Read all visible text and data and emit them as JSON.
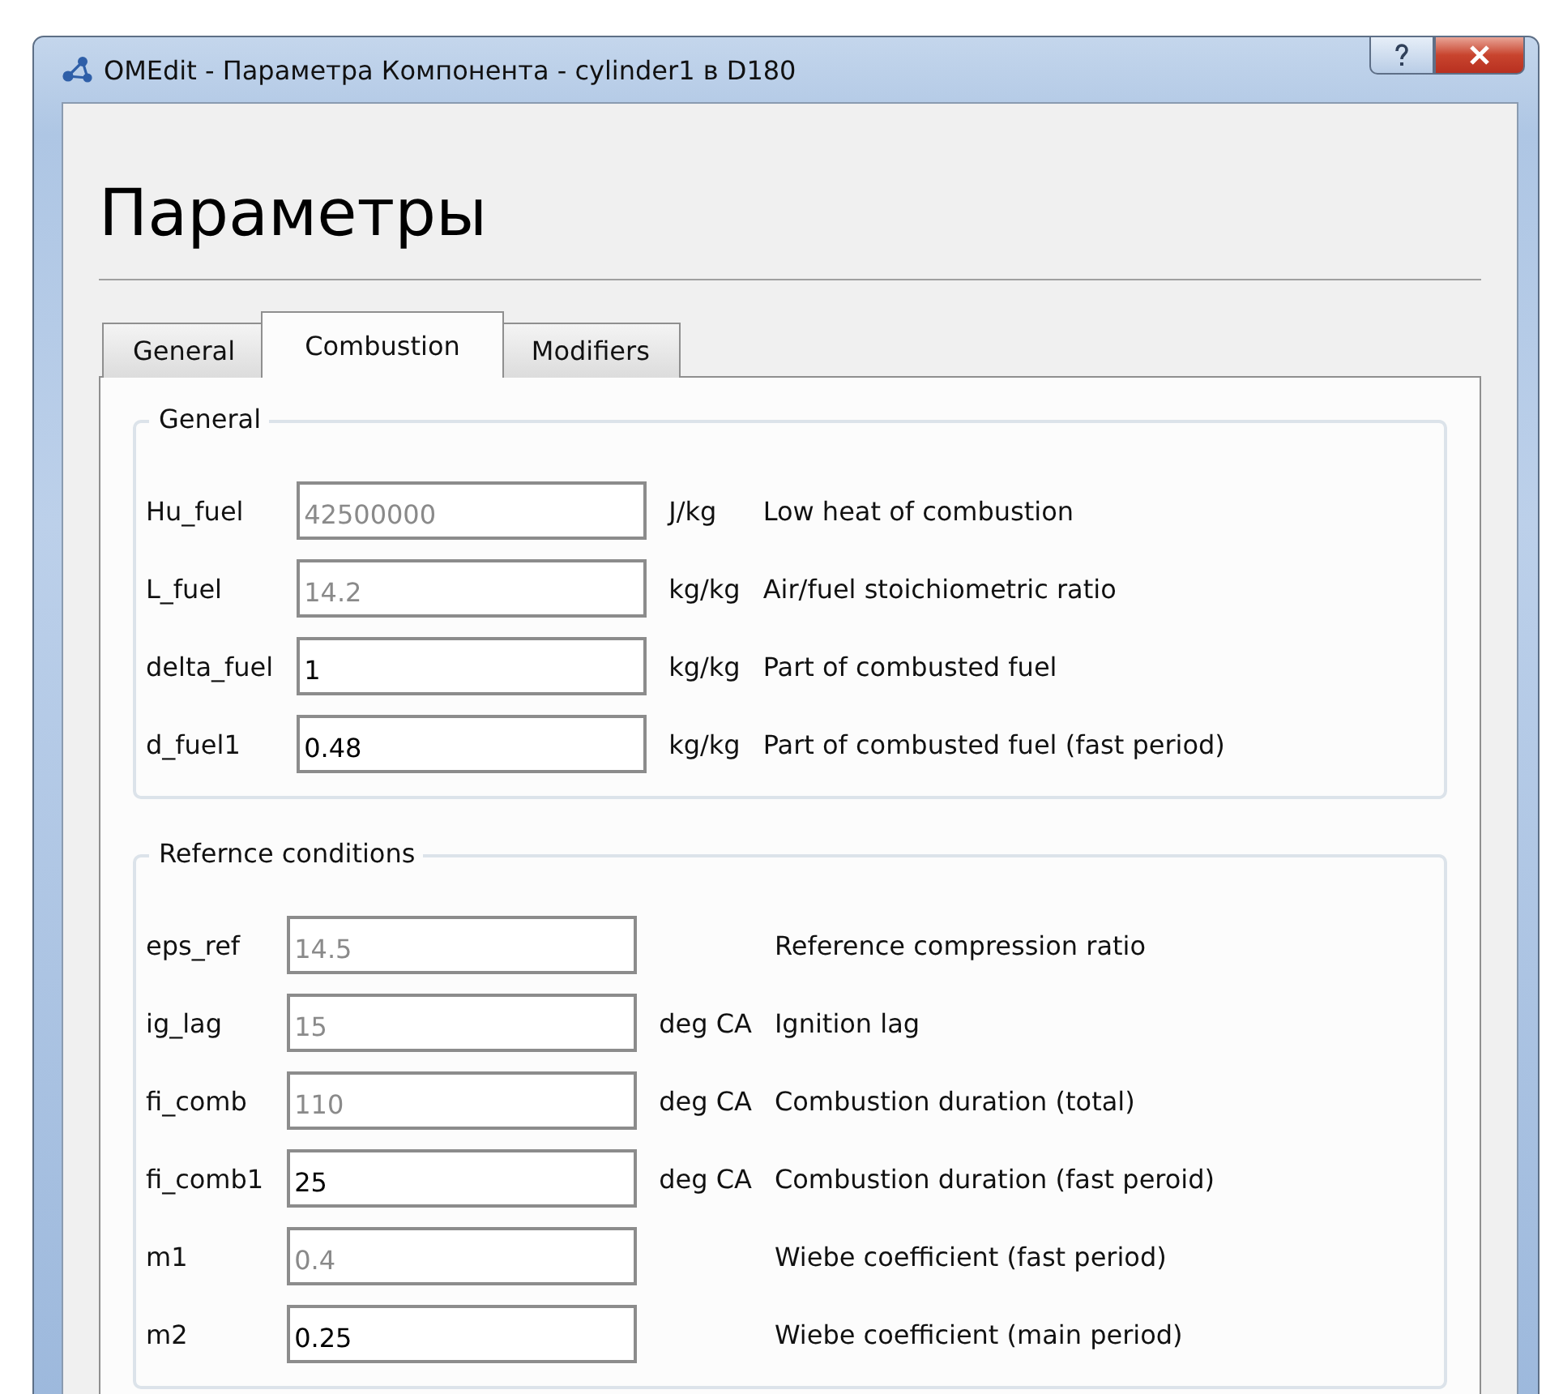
{
  "window": {
    "title": "OMEdit - Параметра Компонента - cylinder1 в D180"
  },
  "heading": "Параметры",
  "tabs": [
    {
      "label": "General",
      "selected": false
    },
    {
      "label": "Combustion",
      "selected": true
    },
    {
      "label": "Modifiers",
      "selected": false
    }
  ],
  "groups": [
    {
      "title": "General",
      "rows": [
        {
          "name": "Hu_fuel",
          "placeholder": "42500000",
          "unit": "J/kg",
          "description": "Low heat of combustion"
        },
        {
          "name": "L_fuel",
          "placeholder": "14.2",
          "unit": "kg/kg",
          "description": "Air/fuel stoichiometric ratio"
        },
        {
          "name": "delta_fuel",
          "value": "1",
          "unit": "kg/kg",
          "description": "Part of combusted fuel"
        },
        {
          "name": "d_fuel1",
          "value": "0.48",
          "unit": "kg/kg",
          "description": "Part of combusted fuel (fast period)"
        }
      ]
    },
    {
      "title": "Refernce conditions",
      "rows": [
        {
          "name": "eps_ref",
          "placeholder": "14.5",
          "description": "Reference compression ratio"
        },
        {
          "name": "ig_lag",
          "placeholder": "15",
          "unit": "deg CA",
          "description": "Ignition lag"
        },
        {
          "name": "fi_comb",
          "placeholder": "110",
          "unit": "deg CA",
          "description": "Combustion duration (total)"
        },
        {
          "name": "fi_comb1",
          "value": "25",
          "unit": "deg CA",
          "description": "Combustion duration (fast peroid)"
        },
        {
          "name": "m1",
          "placeholder": "0.4",
          "description": "Wiebe coefficient (fast period)"
        },
        {
          "name": "m2",
          "value": "0.25",
          "description": "Wiebe coefficient (main period)"
        }
      ]
    }
  ]
}
